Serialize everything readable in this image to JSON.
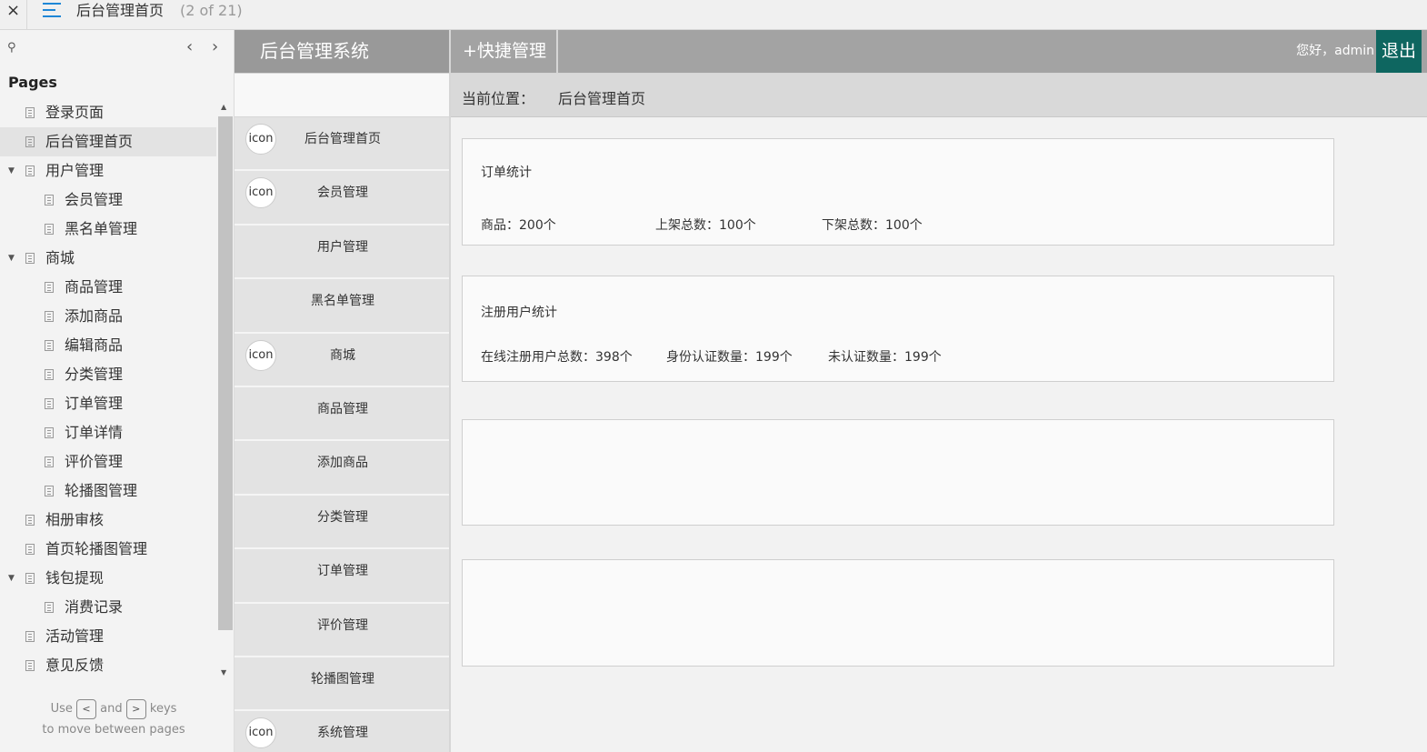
{
  "viewer": {
    "close_glyph": "×",
    "title": "后台管理首页",
    "page_count": "(2 of 21)",
    "pages_heading": "Pages",
    "hint_use": "Use",
    "hint_prev_key": "<",
    "hint_and": "and",
    "hint_next_key": ">",
    "hint_keys": "keys",
    "hint_line2": "to move between pages"
  },
  "pages": [
    {
      "label": "登录页面",
      "level": 0,
      "expanded": null,
      "selected": false
    },
    {
      "label": "后台管理首页",
      "level": 0,
      "expanded": null,
      "selected": true
    },
    {
      "label": "用户管理",
      "level": 0,
      "expanded": true,
      "selected": false
    },
    {
      "label": "会员管理",
      "level": 1,
      "expanded": null,
      "selected": false
    },
    {
      "label": "黑名单管理",
      "level": 1,
      "expanded": null,
      "selected": false
    },
    {
      "label": "商城",
      "level": 0,
      "expanded": true,
      "selected": false
    },
    {
      "label": "商品管理",
      "level": 1,
      "expanded": null,
      "selected": false
    },
    {
      "label": "添加商品",
      "level": 1,
      "expanded": null,
      "selected": false
    },
    {
      "label": "编辑商品",
      "level": 1,
      "expanded": null,
      "selected": false
    },
    {
      "label": "分类管理",
      "level": 1,
      "expanded": null,
      "selected": false
    },
    {
      "label": "订单管理",
      "level": 1,
      "expanded": null,
      "selected": false
    },
    {
      "label": "订单详情",
      "level": 1,
      "expanded": null,
      "selected": false
    },
    {
      "label": "评价管理",
      "level": 1,
      "expanded": null,
      "selected": false
    },
    {
      "label": "轮播图管理",
      "level": 1,
      "expanded": null,
      "selected": false
    },
    {
      "label": "相册审核",
      "level": 0,
      "expanded": null,
      "selected": false
    },
    {
      "label": "首页轮播图管理",
      "level": 0,
      "expanded": null,
      "selected": false
    },
    {
      "label": "钱包提现",
      "level": 0,
      "expanded": true,
      "selected": false
    },
    {
      "label": "消费记录",
      "level": 1,
      "expanded": null,
      "selected": false
    },
    {
      "label": "活动管理",
      "level": 0,
      "expanded": null,
      "selected": false
    },
    {
      "label": "意见反馈",
      "level": 0,
      "expanded": null,
      "selected": false
    }
  ],
  "header": {
    "system_title": "后台管理系统",
    "quick_manage": "+快捷管理",
    "greeting": "您好，admin",
    "logout": "退出",
    "logout_color": "#0e6660"
  },
  "nav": [
    {
      "label": "后台管理首页",
      "icon": "icon"
    },
    {
      "label": "会员管理",
      "icon": "icon"
    },
    {
      "label": "用户管理",
      "icon": null
    },
    {
      "label": "黑名单管理",
      "icon": null
    },
    {
      "label": "商城",
      "icon": "icon"
    },
    {
      "label": "商品管理",
      "icon": null
    },
    {
      "label": "添加商品",
      "icon": null
    },
    {
      "label": "分类管理",
      "icon": null
    },
    {
      "label": "订单管理",
      "icon": null
    },
    {
      "label": "评价管理",
      "icon": null
    },
    {
      "label": "轮播图管理",
      "icon": null
    },
    {
      "label": "系统管理",
      "icon": "icon"
    }
  ],
  "breadcrumb": {
    "label": "当前位置：",
    "value": "后台管理首页"
  },
  "cards": {
    "orders": {
      "title": "订单统计",
      "stats": [
        "商品：200个",
        "上架总数：100个",
        "下架总数：100个"
      ]
    },
    "users": {
      "title": "注册用户统计",
      "stats": [
        "在线注册用户总数：398个",
        "身份认证数量：199个",
        "未认证数量：199个"
      ]
    }
  }
}
